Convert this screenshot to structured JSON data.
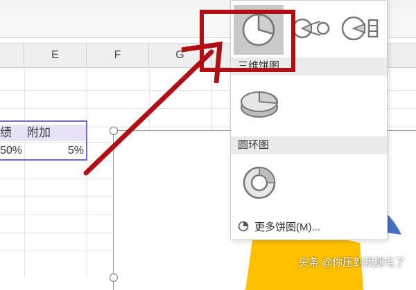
{
  "columns": [
    "E",
    "F",
    "G"
  ],
  "table": {
    "header_left": "绩",
    "header_right": "附加",
    "value_left": "50%",
    "value_right": "5%"
  },
  "dropdown": {
    "section_3d": "三维饼图",
    "section_doughnut": "圆环图",
    "more_label": "更多饼图(M)..."
  },
  "watermark": "头条 @你压到我腿毛了",
  "colors": {
    "highlight": "#b01015",
    "pie_yellow": "#ffc000",
    "pie_blue": "#4472c4",
    "selection_border": "#7b68c8"
  }
}
